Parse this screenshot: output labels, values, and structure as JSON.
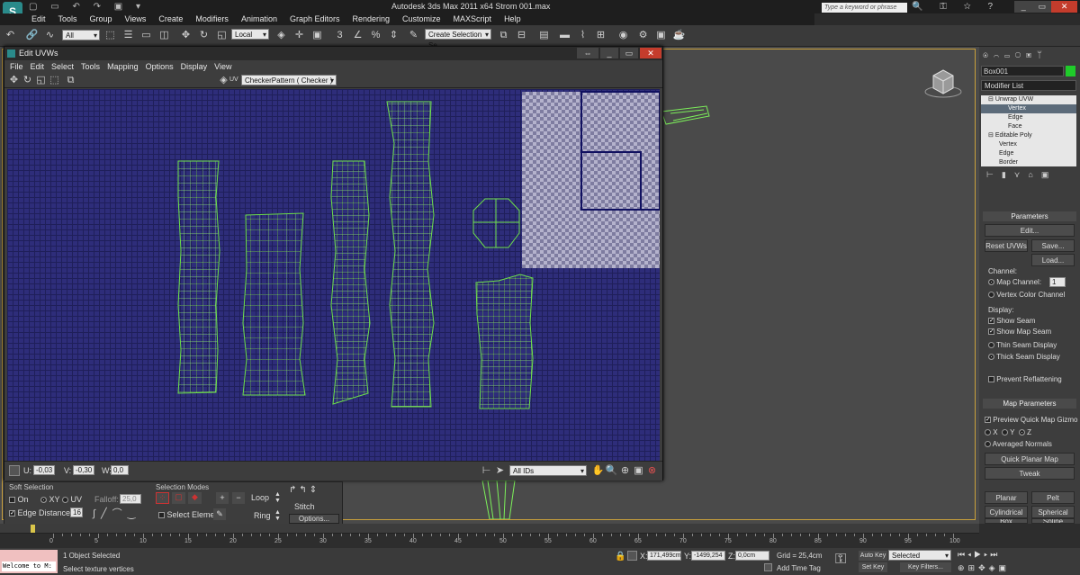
{
  "app": {
    "title": "Autodesk 3ds Max  2011 x64      Strom 001.max",
    "search_placeholder": "Type a keyword or phrase"
  },
  "menu": [
    "Edit",
    "Tools",
    "Group",
    "Views",
    "Create",
    "Modifiers",
    "Animation",
    "Graph Editors",
    "Rendering",
    "Customize",
    "MAXScript",
    "Help"
  ],
  "toolbar": {
    "filter": "All",
    "ref_coord": "Local",
    "selection_set": "Create Selection Se"
  },
  "uvw": {
    "title": "Edit UVWs",
    "menu": [
      "File",
      "Edit",
      "Select",
      "Tools",
      "Mapping",
      "Options",
      "Display",
      "View"
    ],
    "map_label": "UV",
    "texture": "CheckerPattern  ( Checker )",
    "u_label": "U:",
    "u_value": "-0,03",
    "v_label": "V:",
    "v_value": "-0,30",
    "w_label": "W:",
    "w_value": "0,0",
    "ids": "All IDs"
  },
  "rollout": {
    "soft_selection": "Soft Selection",
    "on": "On",
    "xy": "XY",
    "uv": "UV",
    "falloff_label": "Falloff:",
    "falloff_value": "25,0",
    "edge_distance": "Edge Distance",
    "edge_value": "16",
    "selection_modes": "Selection Modes",
    "loop": "Loop",
    "ring": "Ring",
    "select_element": "Select Element",
    "stitch": "Stitch",
    "options": "Options..."
  },
  "command_panel": {
    "object_name": "Box001",
    "modifier_list": "Modifier List",
    "stack": [
      "Unwrap UVW",
      "Vertex",
      "Edge",
      "Face",
      "Editable Poly",
      "Vertex",
      "Edge",
      "Border"
    ],
    "parameters": "Parameters",
    "edit": "Edit...",
    "reset": "Reset UVWs",
    "save": "Save...",
    "load": "Load...",
    "channel": "Channel:",
    "map_channel": "Map Channel:",
    "map_channel_value": "1",
    "vertex_color": "Vertex Color Channel",
    "display": "Display:",
    "show_seam": "Show Seam",
    "show_map_seam": "Show Map Seam",
    "thin_seam": "Thin Seam Display",
    "thick_seam": "Thick Seam Display",
    "prevent": "Prevent Reflattening",
    "map_params": "Map Parameters",
    "preview_gizmo": "Preview Quick Map Gizmo",
    "x": "X",
    "y": "Y",
    "z": "Z",
    "averaged": "Averaged Normals",
    "quick_planar": "Quick Planar Map",
    "tweak": "Tweak",
    "planar": "Planar",
    "pelt": "Pelt",
    "cylindrical": "Cylindrical",
    "spherical": "Spherical",
    "box": "Box",
    "spline": "Spline"
  },
  "timeline": {
    "ticks": [
      "0",
      "5",
      "10",
      "15",
      "20",
      "25",
      "30",
      "35",
      "40",
      "45",
      "50",
      "55",
      "60",
      "65",
      "70",
      "75",
      "80",
      "85",
      "90",
      "95",
      "100"
    ]
  },
  "status": {
    "welcome": "Welcome to M:",
    "selected": "1 Object Selected",
    "prompt": "Select texture vertices",
    "x_label": "X:",
    "x_value": "171,499cm",
    "y_label": "Y:",
    "y_value": "-1499,254",
    "z_label": "Z:",
    "z_value": "0,0cm",
    "grid": "Grid = 25,4cm",
    "add_time_tag": "Add Time Tag",
    "auto_key": "Auto Key",
    "set_key": "Set Key",
    "selected_dd": "Selected",
    "key_filters": "Key Filters..."
  }
}
